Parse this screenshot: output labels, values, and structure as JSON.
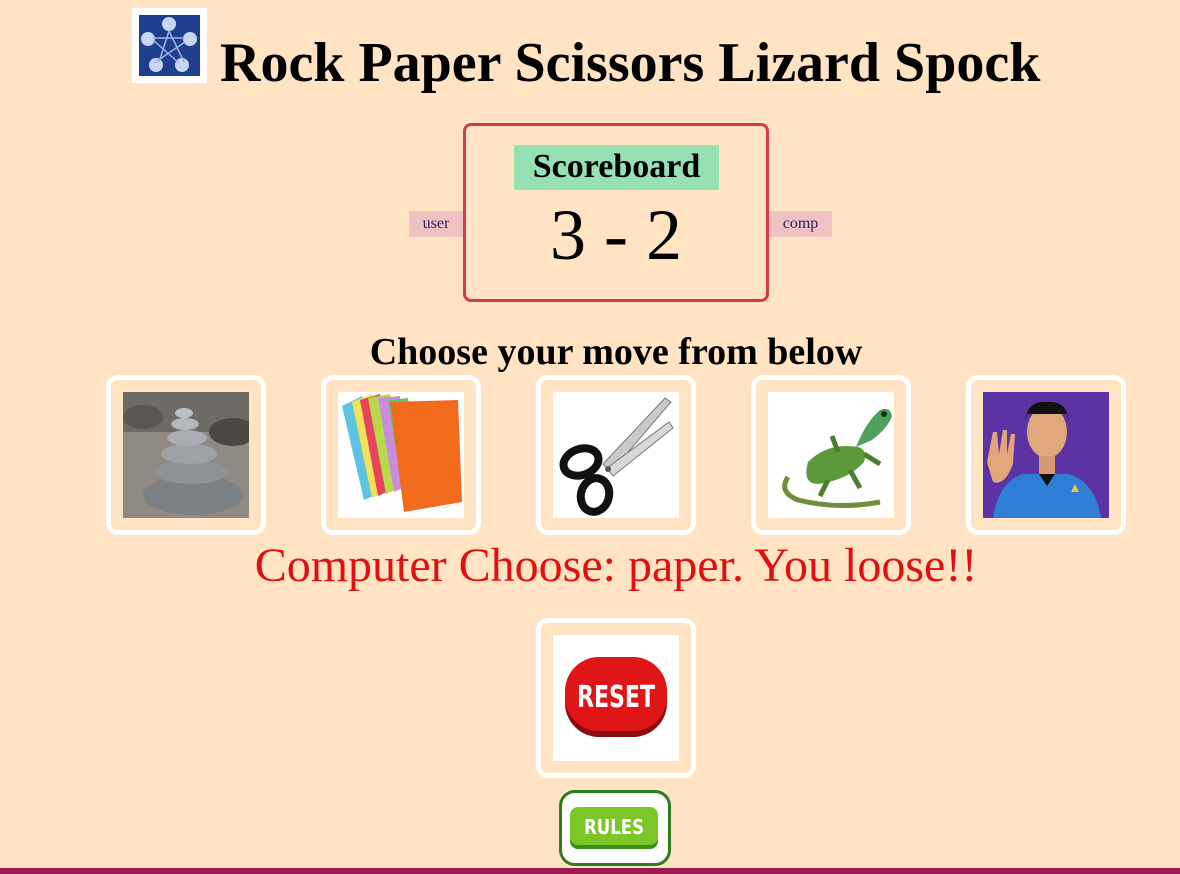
{
  "header": {
    "title": "Rock Paper Scissors Lizard Spock",
    "logo_icon": "rpsls-diagram-icon"
  },
  "scoreboard": {
    "title": "Scoreboard",
    "score": "3 - 2",
    "user_label": "user",
    "comp_label": "comp"
  },
  "moves": {
    "prompt": "Choose your move from below",
    "options": [
      {
        "name": "rock",
        "icon": "rock-stack-icon"
      },
      {
        "name": "paper",
        "icon": "paper-sheets-icon"
      },
      {
        "name": "scissors",
        "icon": "scissors-icon"
      },
      {
        "name": "lizard",
        "icon": "lizard-icon"
      },
      {
        "name": "spock",
        "icon": "spock-icon"
      }
    ]
  },
  "result": {
    "message": "Computer Choose: paper. You loose!!",
    "color": "#e01010"
  },
  "controls": {
    "reset_label": "RESET",
    "rules_label": "RULES"
  },
  "colors": {
    "background": "#ffe3c2",
    "scoreboard_border": "#d43b47",
    "scoreboard_title_bg": "#96e0b4",
    "tag_bg": "#f0c2c2",
    "bottom_bar": "#9b1b52"
  }
}
